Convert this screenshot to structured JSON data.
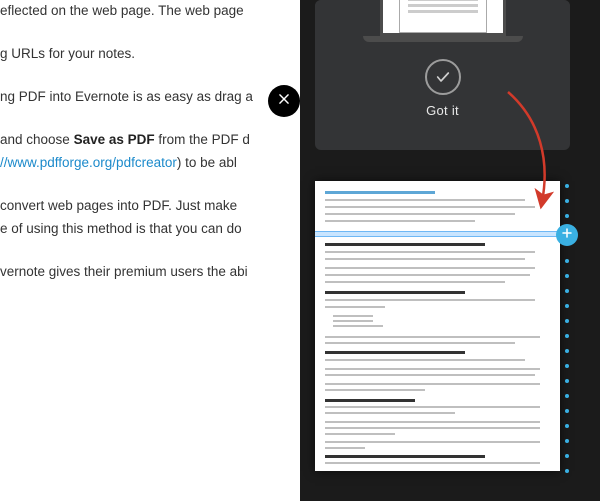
{
  "article": {
    "line1": "eflected on the web page. The web page ",
    "line2": "g URLs for your notes.",
    "line3a": "ng PDF into Evernote is as easy as drag a",
    "line4a": " and choose ",
    "line4b": "Save as PDF",
    "line4c": " from the PDF d",
    "line5a": "//www.pdfforge.org/pdfcreator",
    "line5b": ") to be abl",
    "line6a": " convert web pages into PDF. Just make ",
    "line6b": "e of using this method is that you can do ",
    "line7": "vernote gives their premium users the abi"
  },
  "onboard": {
    "gotit_label": "Got it"
  },
  "colors": {
    "accent": "#3ab0e2",
    "link": "#1c8acb",
    "drawer": "#1b1b1b",
    "arrow": "#d23a2a"
  }
}
